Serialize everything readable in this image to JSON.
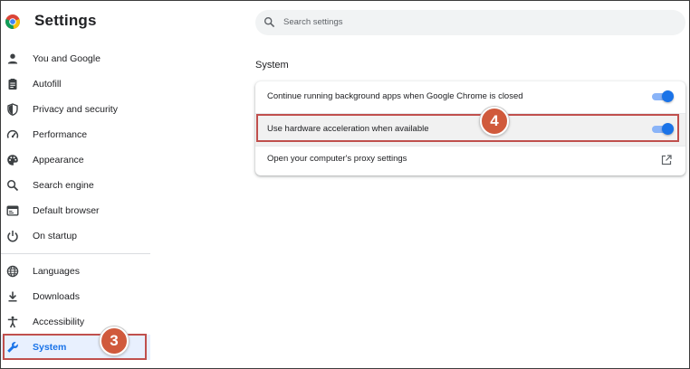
{
  "app": {
    "title": "Settings",
    "logo_icon": "chrome-logo-icon"
  },
  "search": {
    "placeholder": "Search settings",
    "icon": "search-icon"
  },
  "sidebar": {
    "items": [
      {
        "label": "You and Google",
        "icon": "person-icon"
      },
      {
        "label": "Autofill",
        "icon": "clipboard-icon"
      },
      {
        "label": "Privacy and security",
        "icon": "shield-icon"
      },
      {
        "label": "Performance",
        "icon": "speedometer-icon"
      },
      {
        "label": "Appearance",
        "icon": "palette-icon"
      },
      {
        "label": "Search engine",
        "icon": "search-icon"
      },
      {
        "label": "Default browser",
        "icon": "browser-icon"
      },
      {
        "label": "On startup",
        "icon": "power-icon"
      },
      {
        "label": "Languages",
        "icon": "globe-icon"
      },
      {
        "label": "Downloads",
        "icon": "download-icon"
      },
      {
        "label": "Accessibility",
        "icon": "accessibility-icon"
      },
      {
        "label": "System",
        "icon": "wrench-icon",
        "active": true
      }
    ]
  },
  "main": {
    "section_title": "System",
    "rows": [
      {
        "label": "Continue running background apps when Google Chrome is closed",
        "control": "toggle",
        "on": true
      },
      {
        "label": "Use hardware acceleration when available",
        "control": "toggle",
        "on": true
      },
      {
        "label": "Open your computer's proxy settings",
        "control": "external-link-icon"
      }
    ]
  },
  "annotations": {
    "step_system": "3",
    "step_hardware": "4",
    "highlight_color": "#c0504d",
    "badge_color": "#d05a3c"
  },
  "colors": {
    "accent": "#1a73e8",
    "toggle_track": "#8ab4f8"
  }
}
